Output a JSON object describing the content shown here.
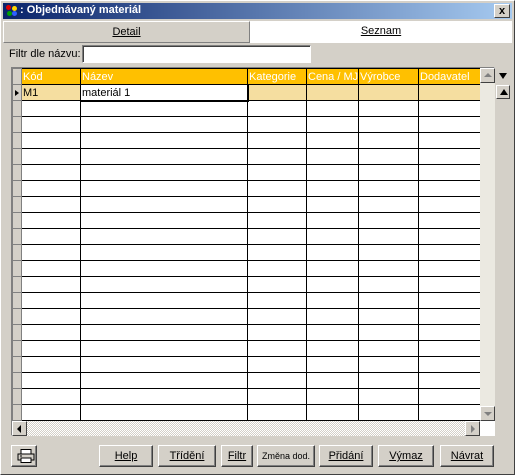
{
  "window": {
    "title": ": Objednávaný materiál",
    "close_label": "x"
  },
  "tabs": [
    {
      "label": "Detail",
      "active": false
    },
    {
      "label": "Seznam",
      "active": true
    }
  ],
  "filter": {
    "label": "Filtr dle názvu:",
    "value": ""
  },
  "grid": {
    "columns": [
      "Kód",
      "Název",
      "Kategorie",
      "Cena / MJ",
      "Výrobce",
      "Dodavatel"
    ],
    "rows": [
      {
        "kod": "M1",
        "nazev": "materiál 1",
        "kategorie": "",
        "cena": "",
        "vyrobce": "",
        "dodavatel": ""
      }
    ],
    "empty_rows": 20
  },
  "buttons": {
    "print": "print-icon",
    "help": "Help",
    "trideni": "Třídění",
    "filtr": "Filtr",
    "zmena": "Změna dod.",
    "pridani": "Přidání",
    "vymaz": "Výmaz",
    "navrat": "Návrat"
  },
  "colors": {
    "header_bg": "#ffc000",
    "selected_row": "#f5dea0",
    "titlebar_start": "#0a246a",
    "titlebar_end": "#a6caf0"
  }
}
